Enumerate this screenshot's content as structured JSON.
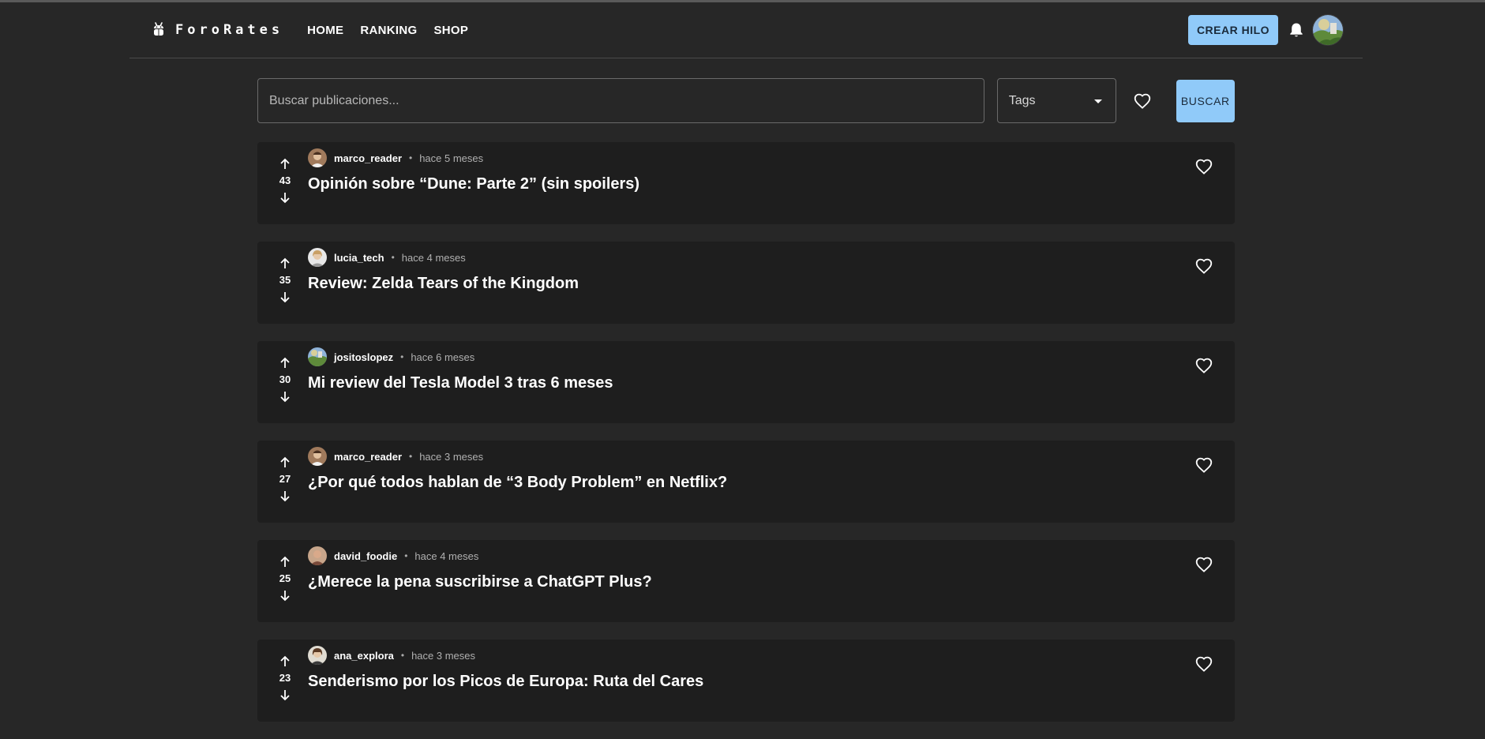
{
  "app": {
    "name": "ForoRates"
  },
  "nav": {
    "links": [
      "HOME",
      "RANKING",
      "SHOP"
    ],
    "create_label": "CREAR HILO"
  },
  "search": {
    "placeholder": "Buscar publicaciones...",
    "value": "",
    "tags_label": "Tags",
    "button_label": "BUSCAR"
  },
  "colors": {
    "background": "#272727",
    "card": "#1e1e1e",
    "accent": "#90caf9"
  },
  "icons": [
    "app-logo-icon",
    "bell-icon",
    "heart-outline-icon",
    "arrow-up-icon",
    "arrow-down-icon",
    "dropdown-arrow-icon"
  ],
  "posts": [
    {
      "votes": "43",
      "author": "marco_reader",
      "time": "hace 5 meses",
      "title": "Opinión sobre “Dune: Parte 2” (sin spoilers)"
    },
    {
      "votes": "35",
      "author": "lucia_tech",
      "time": "hace 4 meses",
      "title": "Review: Zelda Tears of the Kingdom"
    },
    {
      "votes": "30",
      "author": "jositoslopez",
      "time": "hace 6 meses",
      "title": "Mi review del Tesla Model 3 tras 6 meses"
    },
    {
      "votes": "27",
      "author": "marco_reader",
      "time": "hace 3 meses",
      "title": "¿Por qué todos hablan de “3 Body Problem” en Netflix?"
    },
    {
      "votes": "25",
      "author": "david_foodie",
      "time": "hace 4 meses",
      "title": "¿Merece la pena suscribirse a ChatGPT Plus?"
    },
    {
      "votes": "23",
      "author": "ana_explora",
      "time": "hace 3 meses",
      "title": "Senderismo por los Picos de Europa: Ruta del Cares"
    }
  ]
}
